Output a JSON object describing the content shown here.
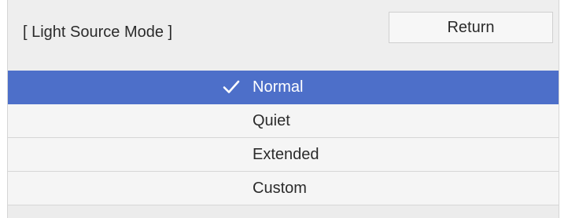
{
  "header": {
    "title": "[ Light Source Mode ]",
    "return_label": "Return"
  },
  "menu": {
    "items": [
      {
        "label": "Normal",
        "selected": true
      },
      {
        "label": "Quiet",
        "selected": false
      },
      {
        "label": "Extended",
        "selected": false
      },
      {
        "label": "Custom",
        "selected": false
      }
    ]
  },
  "colors": {
    "selected_bg": "#4d6fc9",
    "panel_bg": "#ececec"
  }
}
